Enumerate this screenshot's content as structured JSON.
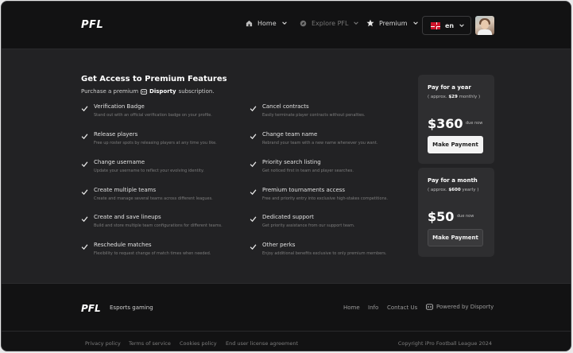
{
  "header": {
    "logo": "PFL",
    "nav": [
      {
        "label": "Home",
        "icon": "home-icon"
      },
      {
        "label": "Explore PFL",
        "icon": "compass-icon"
      },
      {
        "label": "Premium",
        "icon": "star-icon"
      }
    ],
    "language": "en"
  },
  "main": {
    "title": "Get Access to Premium Features",
    "subtitle_prefix": "Purchase a premium",
    "brand": "Disporty",
    "subtitle_suffix": "subscription.",
    "features_left": [
      {
        "name": "Verification Badge",
        "desc": "Stand out with an official verification badge on your profile."
      },
      {
        "name": "Release players",
        "desc": "Free up roster spots by releasing players at any time you like."
      },
      {
        "name": "Change username",
        "desc": "Update your username to reflect your evolving identity."
      },
      {
        "name": "Create multiple teams",
        "desc": "Create and manage several teams across different leagues."
      },
      {
        "name": "Create and save lineups",
        "desc": "Build and store multiple team configurations for different teams."
      },
      {
        "name": "Reschedule matches",
        "desc": "Flexibility to request change of match times when needed."
      }
    ],
    "features_right": [
      {
        "name": "Cancel contracts",
        "desc": "Easily terminate player contracts without penalties."
      },
      {
        "name": "Change team name",
        "desc": "Rebrand your team with a new name whenever you want."
      },
      {
        "name": "Priority search listing",
        "desc": "Get noticed first in team and player searches."
      },
      {
        "name": "Premium tournaments access",
        "desc": "Free and priority entry into exclusive high-stakes competitions."
      },
      {
        "name": "Dedicated support",
        "desc": "Get priority assistance from our support team."
      },
      {
        "name": "Other perks",
        "desc": "Enjoy additional benefits exclusive to only premium members."
      }
    ],
    "plans": [
      {
        "title": "Pay for a year",
        "approx_prefix": "( approx.",
        "approx_value": "$29",
        "approx_suffix": "monthly )",
        "price": "$360",
        "due": "due now",
        "button": "Make Payment"
      },
      {
        "title": "Pay for a month",
        "approx_prefix": "( approx.",
        "approx_value": "$600",
        "approx_suffix": "yearly )",
        "price": "$50",
        "due": "due now",
        "button": "Make Payment"
      }
    ]
  },
  "footer": {
    "logo": "PFL",
    "tagline": "Esports gaming",
    "links": [
      "Home",
      "Info",
      "Contact Us"
    ],
    "powered": "Powered by Disporty",
    "legal": [
      "Privacy policy",
      "Terms of service",
      "Cookies policy",
      "End user license agreement"
    ],
    "copyright": "Copyright iPro Football League 2024"
  }
}
